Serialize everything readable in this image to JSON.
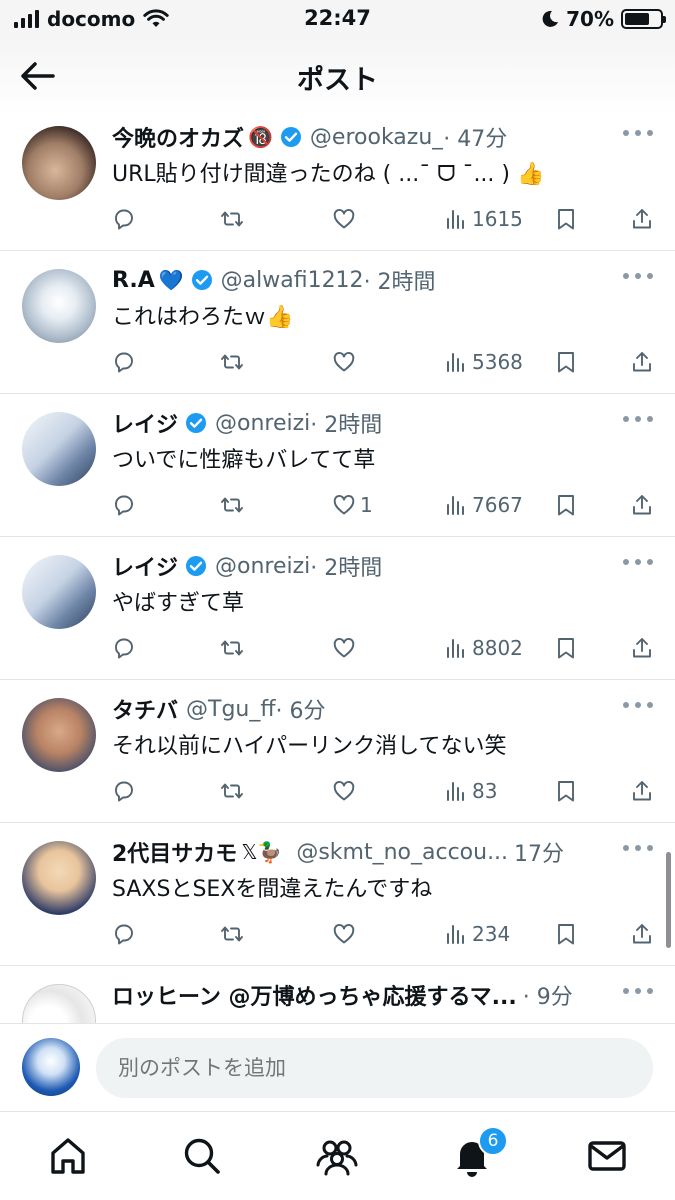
{
  "status_bar": {
    "carrier": "docomo",
    "time": "22:47",
    "battery": "70%",
    "battery_level": 0.7
  },
  "header": {
    "title": "ポスト",
    "back_icon": "arrow-left-icon"
  },
  "posts": [
    {
      "author": "今晩のオカズ",
      "author_emoji": "🔞",
      "handle": "@erookazu_",
      "time": "· 47分",
      "text": "URL貼り付け間違ったのね ( ...¯ ᗜ ¯... ) 👍",
      "likes": "",
      "views": "1615"
    },
    {
      "author": "R.A",
      "author_emoji": "💙",
      "handle": "@alwafi1212",
      "time": "· 2時間",
      "text": "これはわろたｗ👍",
      "likes": "",
      "views": "5368"
    },
    {
      "author": "レイジ",
      "author_emoji": "",
      "handle": "@onreizi",
      "time": "· 2時間",
      "text": "ついでに性癖もバレてて草",
      "likes": "1",
      "views": "7667"
    },
    {
      "author": "レイジ",
      "author_emoji": "",
      "handle": "@onreizi",
      "time": "· 2時間",
      "text": "やばすぎて草",
      "likes": "",
      "views": "8802"
    },
    {
      "author": "タチバ",
      "author_emoji": "",
      "handle": "@Tgu_ff",
      "time": "· 6分",
      "text": "それ以前にハイパーリンク消してない笑",
      "likes": "",
      "views": "83"
    },
    {
      "author": "2代目サカモ",
      "author_emoji": "𝕏🦆",
      "handle": "@skmt_no_accou...",
      "time": "17分",
      "text": "SAXSとSEXを間違えたんですね",
      "likes": "",
      "views": "234"
    },
    {
      "author": "ロッヒーン @万博めっちゃ応援するマ...",
      "author_emoji": "",
      "handle": "",
      "time": "· 9分",
      "text": "",
      "likes": "",
      "views": ""
    }
  ],
  "composer": {
    "placeholder": "別のポストを追加"
  },
  "tabbar": {
    "notifications_badge": "6",
    "icons": [
      "home-icon",
      "search-icon",
      "communities-icon",
      "notifications-icon",
      "messages-icon"
    ]
  },
  "colors": {
    "accent": "#1d9bf0",
    "text": "#0f1419",
    "secondary": "#536471"
  }
}
